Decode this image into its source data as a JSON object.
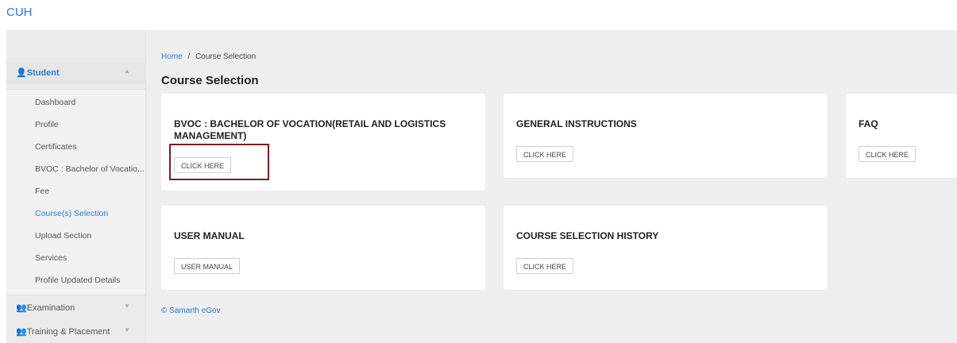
{
  "app": {
    "brand": "CUH"
  },
  "sidebar": {
    "student": {
      "icon": "person-icon",
      "label": "👤Student",
      "chevron": "▲"
    },
    "items": [
      {
        "label": "Dashboard",
        "active": false
      },
      {
        "label": "Profile",
        "active": false
      },
      {
        "label": "Certificates",
        "active": false
      },
      {
        "label": "BVOC : Bachelor of Vocatio...",
        "active": false
      },
      {
        "label": "Fee",
        "active": false
      },
      {
        "label": "Course(s) Selection",
        "active": true
      },
      {
        "label": "Upload Section",
        "active": false
      },
      {
        "label": "Services",
        "active": false
      },
      {
        "label": "Profile Updated Details",
        "active": false
      }
    ],
    "examination": {
      "label": "👥Examination",
      "chevron": "▼"
    },
    "training": {
      "label": "👥Training & Placement",
      "chevron": "▼"
    }
  },
  "breadcrumb": {
    "home": "Home",
    "separator": "/",
    "current": "Course Selection"
  },
  "page": {
    "title": "Course Selection"
  },
  "cards": {
    "bvoc": {
      "title": "BVOC : BACHELOR OF VOCATION(RETAIL AND LOGISTICS MANAGEMENT)",
      "button": "CLICK HERE"
    },
    "general": {
      "title": "GENERAL INSTRUCTIONS",
      "button": "CLICK HERE"
    },
    "faq": {
      "title": "FAQ",
      "button": "CLICK HERE"
    },
    "manual": {
      "title": "USER MANUAL",
      "button": "USER MANUAL"
    },
    "history": {
      "title": "COURSE SELECTION HISTORY",
      "button": "CLICK HERE"
    }
  },
  "footer": {
    "text": "© Samarth eGov"
  },
  "colors": {
    "accent": "#2a7bd9",
    "highlight": "#7d1b22",
    "background": "#eeeeee"
  }
}
